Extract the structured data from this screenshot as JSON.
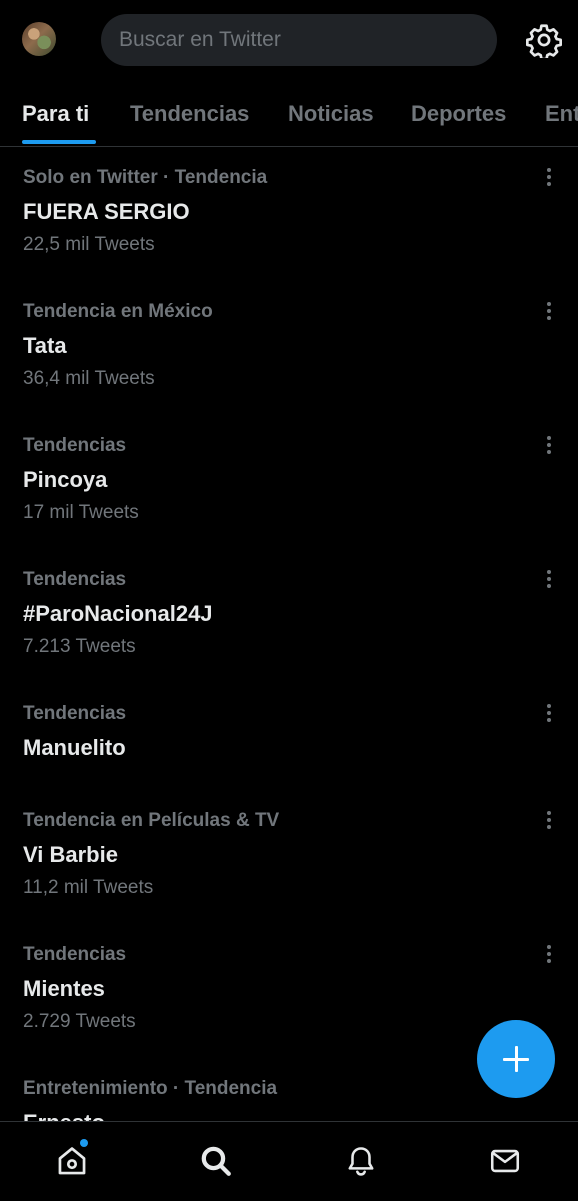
{
  "header": {
    "search_placeholder": "Buscar en Twitter"
  },
  "tabs": [
    {
      "label": "Para ti",
      "active": true
    },
    {
      "label": "Tendencias",
      "active": false
    },
    {
      "label": "Noticias",
      "active": false
    },
    {
      "label": "Deportes",
      "active": false
    },
    {
      "label": "Ent",
      "active": false
    }
  ],
  "trends": [
    {
      "context": "Solo en Twitter · Tendencia",
      "title": "FUERA SERGIO",
      "count": "22,5 mil Tweets"
    },
    {
      "context": "Tendencia en México",
      "title": "Tata",
      "count": "36,4 mil Tweets"
    },
    {
      "context": "Tendencias",
      "title": "Pincoya",
      "count": "17 mil Tweets"
    },
    {
      "context": "Tendencias",
      "title": "#ParoNacional24J",
      "count": "7.213 Tweets"
    },
    {
      "context": "Tendencias",
      "title": "Manuelito",
      "count": ""
    },
    {
      "context": "Tendencia en Películas & TV",
      "title": "Vi Barbie",
      "count": "11,2 mil Tweets"
    },
    {
      "context": "Tendencias",
      "title": "Mientes",
      "count": "2.729 Tweets"
    },
    {
      "context": "Entretenimiento · Tendencia",
      "title": "Ernesto",
      "count": ""
    }
  ],
  "bottom_nav": {
    "items": [
      "home-icon",
      "search-icon",
      "bell-icon",
      "mail-icon"
    ],
    "home_has_notification": true
  },
  "colors": {
    "background": "#000000",
    "accent": "#1d9bf0",
    "secondary_text": "#71767b",
    "primary_text": "#e7e9ea"
  }
}
